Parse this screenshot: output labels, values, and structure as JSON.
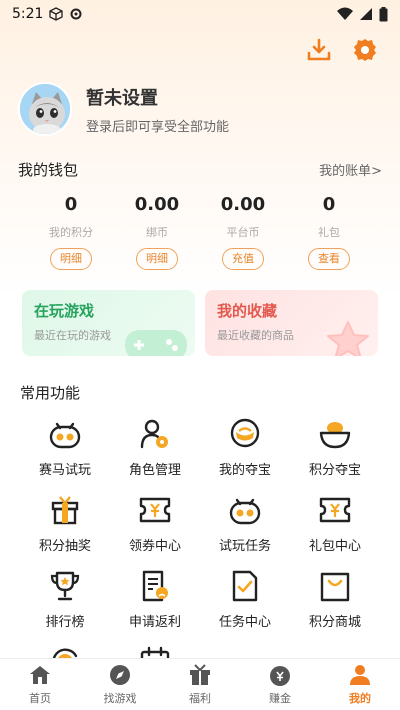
{
  "status_bar": {
    "time": "5:21"
  },
  "profile": {
    "name": "暂未设置",
    "subtitle": "登录后即可享受全部功能"
  },
  "wallet": {
    "title": "我的钱包",
    "link": "我的账单>",
    "stats": [
      {
        "value": "0",
        "label": "我的积分",
        "button": "明细"
      },
      {
        "value": "0.00",
        "label": "绑币",
        "button": "明细"
      },
      {
        "value": "0.00",
        "label": "平台币",
        "button": "充值"
      },
      {
        "value": "0",
        "label": "礼包",
        "button": "查看"
      }
    ]
  },
  "cards": [
    {
      "title": "在玩游戏",
      "subtitle": "最近在玩的游戏"
    },
    {
      "title": "我的收藏",
      "subtitle": "最近收藏的商品"
    }
  ],
  "functions": {
    "title": "常用功能",
    "items": [
      {
        "label": "赛马试玩",
        "icon": "gamepad-icon"
      },
      {
        "label": "角色管理",
        "icon": "role-manage-icon"
      },
      {
        "label": "我的夺宝",
        "icon": "treasure-icon"
      },
      {
        "label": "积分夺宝",
        "icon": "ingot-icon"
      },
      {
        "label": "积分抽奖",
        "icon": "gift-box-icon"
      },
      {
        "label": "领券中心",
        "icon": "coupon-icon"
      },
      {
        "label": "试玩任务",
        "icon": "gamepad-icon"
      },
      {
        "label": "礼包中心",
        "icon": "gift-coupon-icon"
      },
      {
        "label": "排行榜",
        "icon": "trophy-icon"
      },
      {
        "label": "申请返利",
        "icon": "rebate-doc-icon"
      },
      {
        "label": "任务中心",
        "icon": "task-check-icon"
      },
      {
        "label": "积分商城",
        "icon": "shop-bag-icon"
      },
      {
        "label": "",
        "icon": "yuan-refresh-icon"
      },
      {
        "label": "",
        "icon": "calendar-check-icon"
      }
    ]
  },
  "nav": {
    "items": [
      {
        "label": "首页",
        "icon": "home-icon"
      },
      {
        "label": "找游戏",
        "icon": "compass-icon"
      },
      {
        "label": "福利",
        "icon": "gift-icon"
      },
      {
        "label": "赚金",
        "icon": "money-bag-icon"
      },
      {
        "label": "我的",
        "icon": "user-icon"
      }
    ],
    "active": "我的"
  },
  "colors": {
    "accent": "#f07d1f",
    "green": "#27a35f",
    "pink": "#e25a4f"
  }
}
